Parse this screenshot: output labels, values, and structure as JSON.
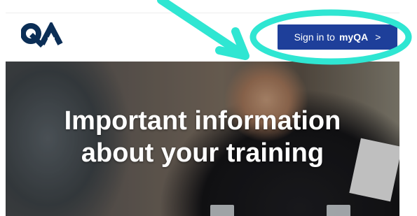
{
  "header": {
    "logo_text": "QA",
    "signin": {
      "prefix": "Sign in to",
      "brand": "myQA",
      "chevron": ">"
    }
  },
  "hero": {
    "heading_line1": "Important information",
    "heading_line2": "about your training"
  },
  "annotation": {
    "color": "#2fe6d2",
    "shapes": [
      "arrow",
      "ellipse"
    ]
  },
  "colors": {
    "button_bg": "#1e3f9a",
    "logo": "#0b2e56"
  }
}
